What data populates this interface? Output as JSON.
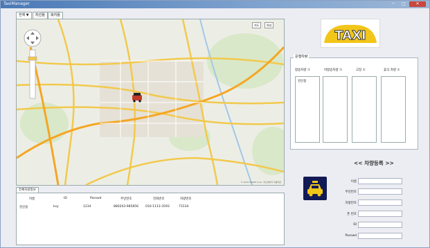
{
  "window": {
    "title": "TaxiManager",
    "minimize": "─",
    "maximize": "□",
    "close": "✕"
  },
  "tabs": [
    {
      "label": "전체 ▼"
    },
    {
      "label": "차선용"
    },
    {
      "label": "복지용"
    }
  ],
  "map": {
    "btn_map": "지도",
    "btn_satellite": "위성",
    "footer": "© 2015 NAVER Corp.  지도데이터  이용약관",
    "zoom_plus": "+",
    "zoom_minus": "−"
  },
  "logo": {
    "text": "TAXI"
  },
  "vehicle_status": {
    "title": "운행차량",
    "columns": [
      {
        "label": "합승차량 ①",
        "items": [
          "김신용"
        ]
      },
      {
        "label": "비합승차량 ①",
        "items": []
      },
      {
        "label": "고장 ①",
        "items": []
      },
      {
        "label": "휴식 차량 ①",
        "items": []
      }
    ]
  },
  "registration": {
    "title": "<< 차량등록 >>",
    "fields": [
      {
        "label": "이름",
        "value": ""
      },
      {
        "label": "주민번호",
        "value": ""
      },
      {
        "label": "차량번호",
        "value": ""
      },
      {
        "label": "폰 번호",
        "value": ""
      },
      {
        "label": "ID",
        "value": ""
      },
      {
        "label": "Passwd",
        "value": ""
      }
    ]
  },
  "driver_list": {
    "tab": "전체차량정보",
    "headers": [
      "이름",
      "ID",
      "Passwd",
      "주민번호",
      "전화번호",
      "차량번호"
    ],
    "rows": [
      [
        "김신용",
        "ksy",
        "1234",
        "880203-985856",
        "010-1113-3593",
        "73134"
      ]
    ]
  },
  "colors": {
    "accent": "#4a79b6",
    "road": "#f2c94c",
    "highway": "#f5a623",
    "water": "#a3c7e8",
    "taxi_icon_bg": "#111a55"
  }
}
